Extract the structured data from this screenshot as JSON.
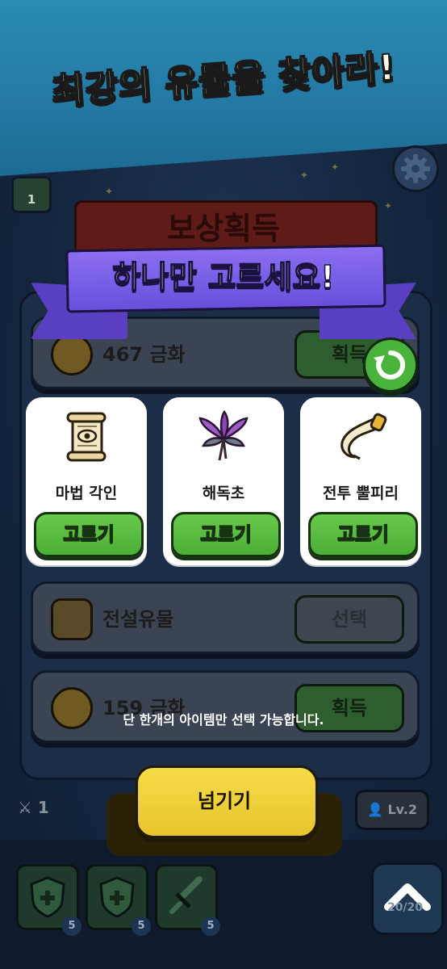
{
  "banner": {
    "title": "최강의 유물을 찾아라!"
  },
  "background": {
    "badge_left": "1",
    "reward_title": "보상획득",
    "rows": [
      {
        "label": "467 금화",
        "button": "획득"
      },
      {
        "label": "전설유물",
        "button": "선택"
      },
      {
        "label": "159 금화",
        "button": "획득"
      }
    ],
    "hud_sword_count": "1",
    "level_badge": "Lv.2",
    "slots": [
      {
        "count": "5"
      },
      {
        "count": "5"
      },
      {
        "count": "5"
      }
    ],
    "up_count": "20/20"
  },
  "ribbon": {
    "text": "하나만 고르세요!"
  },
  "cards": [
    {
      "name": "마법 각인",
      "button": "고르기",
      "icon": "scroll-icon"
    },
    {
      "name": "해독초",
      "button": "고르기",
      "icon": "herb-icon"
    },
    {
      "name": "전투 뿔피리",
      "button": "고르기",
      "icon": "horn-icon"
    }
  ],
  "notice": "단 한개의 아이템만 선택 가능합니다.",
  "skip_button": "넘기기",
  "colors": {
    "banner": "#2379a3",
    "ribbon": "#7a5ee8",
    "pick_green": "#4caf36",
    "skip_yellow": "#f0d03a"
  }
}
